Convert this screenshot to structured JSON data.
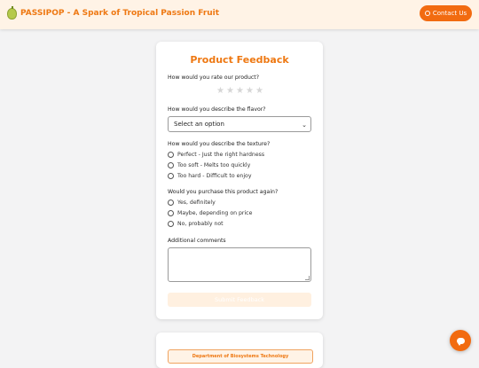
{
  "header": {
    "brand": "PASSIPOP - A Spark of Tropical Passion Fruit",
    "logo_icon": "passion-fruit-icon",
    "contact_label": "Contact Us",
    "contact_icon": "whatsapp-icon"
  },
  "form": {
    "title": "Product Feedback",
    "rating_question": "How would you rate our product?",
    "rating": {
      "value": 0,
      "max": 5
    },
    "flavor_question": "How would you describe the flavor?",
    "flavor_select": {
      "selected": "Select an option"
    },
    "texture_question": "How would you describe the texture?",
    "texture_options": [
      "Perfect - Just the right hardness",
      "Too soft - Melts too quickly",
      "Too hard - Difficult to enjoy"
    ],
    "purchase_question": "Would you purchase this product again?",
    "purchase_options": [
      "Yes, definitely",
      "Maybe, depending on price",
      "No, probably not"
    ],
    "comments_label": "Additional comments",
    "comments_value": "",
    "submit_label": "Submit Feedback"
  },
  "footer_card": {
    "department": "Department of Biosystems Technology"
  },
  "colors": {
    "accent": "#ee7812",
    "button": "#f26b10",
    "header_bg": "#fff3e6"
  }
}
